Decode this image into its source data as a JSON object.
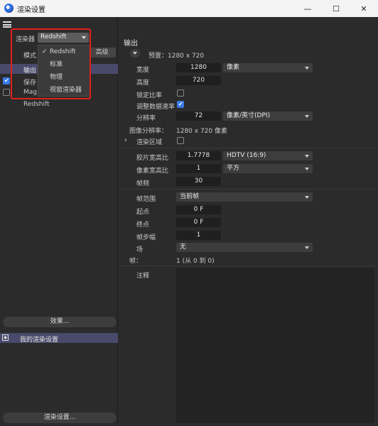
{
  "window": {
    "title": "渲染设置",
    "minimize": "—",
    "maximize": "☐",
    "close": "✕"
  },
  "left": {
    "renderer_label": "渲染器",
    "renderer_value": "Redshift",
    "mode_label": "模式",
    "advanced_tab": "高级",
    "items": [
      "输出",
      "保存",
      "Mag",
      "Redshift"
    ],
    "dropdown": [
      "Redshift",
      "标准",
      "物理",
      "视窗渲染器"
    ],
    "effect_button": "效果...",
    "my_settings": "我的渲染设置",
    "render_settings_button": "渲染设置..."
  },
  "right": {
    "section_title": "输出",
    "preset": "预置：1280 x 720",
    "width_label": "宽度",
    "width_value": "1280",
    "width_unit": "像素",
    "height_label": "高度",
    "height_value": "720",
    "lock_ratio_label": "锁定比率",
    "adjust_rate_label": "调整数据速率",
    "resolution_label": "分辨率",
    "resolution_value": "72",
    "resolution_unit": "像素/英寸(DPI)",
    "image_res_label": "图像分辨率：",
    "image_res_value": "1280 x 720 像素",
    "render_region_label": "渲染区域",
    "film_ratio_label": "胶片宽高比",
    "film_ratio_value": "1.7778",
    "film_ratio_preset": "HDTV (16:9)",
    "pixel_ratio_label": "像素宽高比",
    "pixel_ratio_value": "1",
    "pixel_ratio_preset": "平方",
    "fps_label": "帧频",
    "fps_value": "30",
    "frame_range_label": "帧范围",
    "frame_range_value": "当前帧",
    "start_label": "起点",
    "start_value": "0 F",
    "end_label": "终点",
    "end_value": "0 F",
    "step_label": "帧步幅",
    "step_value": "1",
    "field_label": "场",
    "field_value": "无",
    "frames_label": "帧：",
    "frames_value": "1 (从 0 到 0)",
    "notes_label": "注释"
  }
}
